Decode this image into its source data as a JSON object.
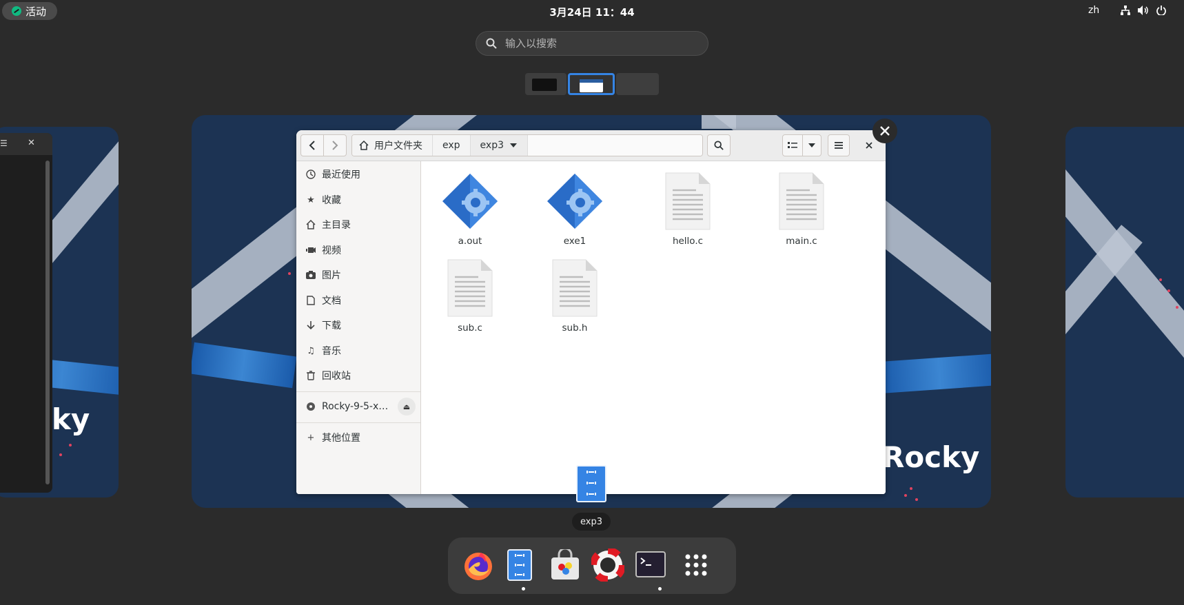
{
  "topbar": {
    "activities_label": "活动",
    "clock": "3月24日  11：44",
    "lang": "zh",
    "tray_icons": [
      "network-icon",
      "volume-icon",
      "power-icon"
    ]
  },
  "search": {
    "placeholder": "输入以搜索"
  },
  "workspaces": {
    "count": 3,
    "active_index": 1
  },
  "files_window": {
    "path": [
      "用户文件夹",
      "exp",
      "exp3"
    ],
    "sidebar": [
      {
        "label": "最近使用",
        "icon": "clock-icon"
      },
      {
        "label": "收藏",
        "icon": "star-icon"
      },
      {
        "label": "主目录",
        "icon": "home-icon"
      },
      {
        "label": "视频",
        "icon": "video-icon"
      },
      {
        "label": "图片",
        "icon": "camera-icon"
      },
      {
        "label": "文档",
        "icon": "document-icon"
      },
      {
        "label": "下载",
        "icon": "download-icon"
      },
      {
        "label": "音乐",
        "icon": "music-icon"
      },
      {
        "label": "回收站",
        "icon": "trash-icon"
      }
    ],
    "device": {
      "label": "Rocky-9-5-x…",
      "icon": "disc-icon"
    },
    "other_locations": "其他位置",
    "files": [
      {
        "name": "a.out",
        "type": "executable"
      },
      {
        "name": "exe1",
        "type": "executable"
      },
      {
        "name": "hello.c",
        "type": "text"
      },
      {
        "name": "main.c",
        "type": "text"
      },
      {
        "name": "sub.c",
        "type": "text"
      },
      {
        "name": "sub.h",
        "type": "text"
      }
    ]
  },
  "wallpaper": {
    "logo_text": "Rocky",
    "partial_logo_text": "cky"
  },
  "tooltip": "exp3",
  "dock": {
    "apps": [
      {
        "name": "firefox-icon",
        "running": false
      },
      {
        "name": "files-icon",
        "running": true
      },
      {
        "name": "software-icon",
        "running": false
      },
      {
        "name": "help-icon",
        "running": false
      },
      {
        "name": "terminal-icon",
        "running": true
      },
      {
        "name": "app-grid-icon",
        "running": false
      }
    ]
  },
  "colors": {
    "accent": "#3584e4",
    "wallpaper": "#1c3353",
    "panel": "#2b2b2b"
  }
}
